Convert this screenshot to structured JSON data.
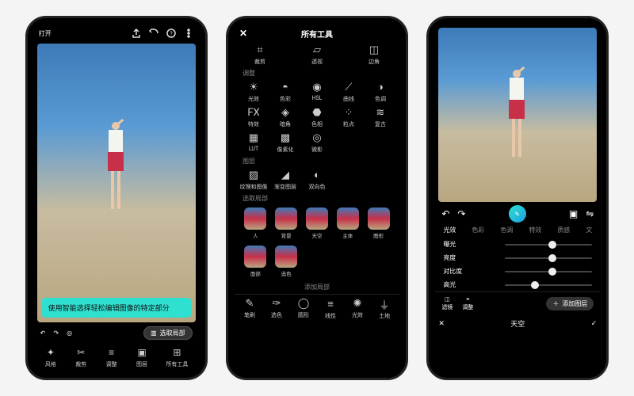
{
  "phone1": {
    "open_label": "打开",
    "tooltip": "使用智能选择轻松编辑图像的特定部分",
    "chip_label": "选取局部",
    "bottom_tools": [
      "风格",
      "裁剪",
      "调整",
      "图层",
      "所有工具"
    ]
  },
  "phone2": {
    "title": "所有工具",
    "basics": [
      "裁剪",
      "透视",
      "边角"
    ],
    "adjust_title": "调整",
    "adjust": [
      "光效",
      "色彩",
      "HSL",
      "曲线",
      "色调"
    ],
    "adjust2": [
      "特效",
      "暗角",
      "色相",
      "粒点",
      "复古"
    ],
    "adjust3": [
      "LUT",
      "像素化",
      "微影"
    ],
    "layers_title": "图层",
    "layers": [
      "纹理和图像",
      "渐变图层",
      "双向色"
    ],
    "select_title": "选取局部",
    "thumbs": [
      "人",
      "背景",
      "天空",
      "主体",
      "图形"
    ],
    "thumbs2": [
      "面部",
      "选色"
    ],
    "add_layer": "添加局部",
    "bottom": [
      "笔刷",
      "选色",
      "圆形",
      "线性",
      "光效",
      "土地"
    ]
  },
  "phone3": {
    "tabs": [
      "光效",
      "色彩",
      "色调",
      "特效",
      "质感",
      "文"
    ],
    "sliders": [
      {
        "label": "曝光",
        "pos": 50
      },
      {
        "label": "亮度",
        "pos": 50
      },
      {
        "label": "对比度",
        "pos": 50
      },
      {
        "label": "高光",
        "pos": 30
      }
    ],
    "mini_tools": [
      "滤镜",
      "调整"
    ],
    "add_layer_chip": "添加图层",
    "footer_label": "天空"
  }
}
